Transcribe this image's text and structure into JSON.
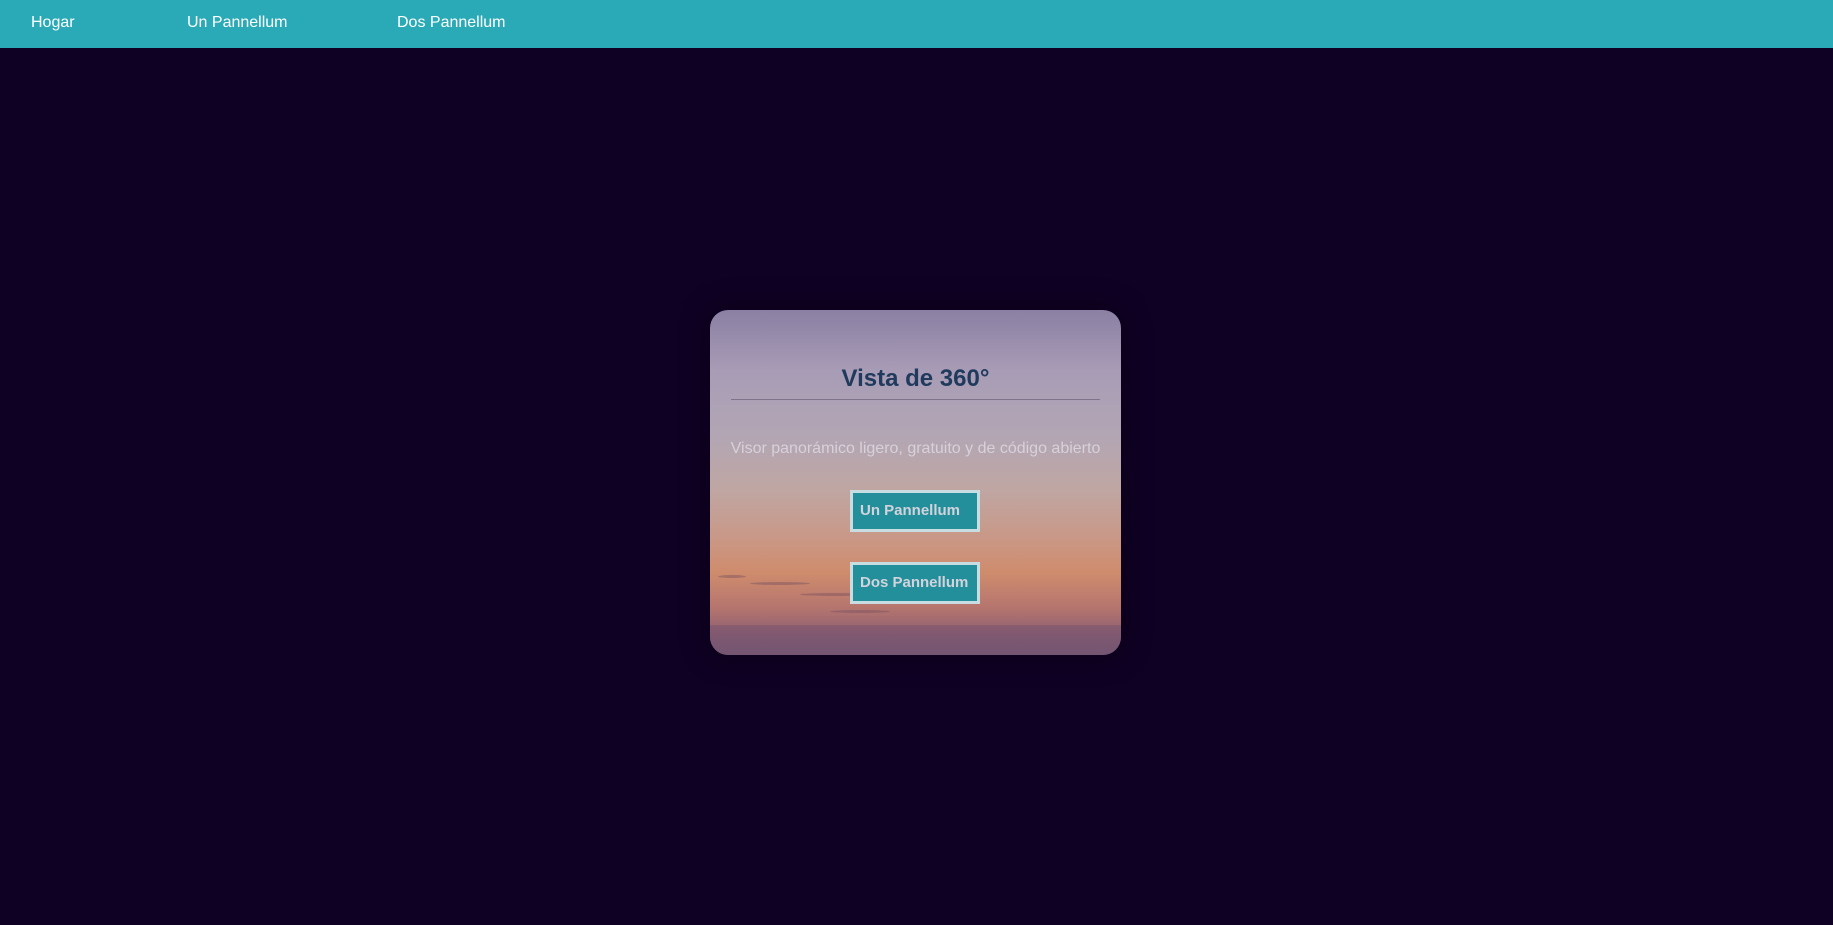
{
  "nav": {
    "items": [
      {
        "label": "Hogar"
      },
      {
        "label": "Un Pannellum"
      },
      {
        "label": "Dos Pannellum"
      }
    ]
  },
  "card": {
    "title": "Vista de 360°",
    "subtitle": "Visor panorámico ligero, gratuito y de código abierto",
    "buttons": [
      {
        "label": "Un Pannellum"
      },
      {
        "label": "Dos Pannellum"
      }
    ]
  },
  "colors": {
    "page_background": "#0f0123",
    "nav_background": "#2aaab6",
    "button_background": "#238f9b",
    "title_color": "#1f3a5c"
  }
}
